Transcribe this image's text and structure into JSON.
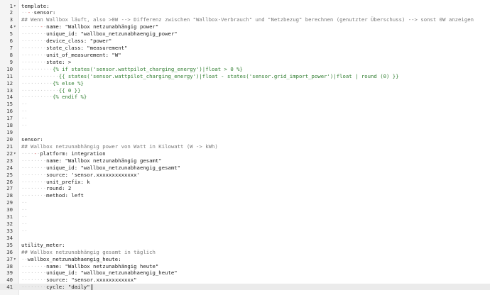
{
  "editor": {
    "active_line": 41,
    "lines": [
      {
        "n": "1",
        "fold": "▾",
        "segs": [
          [
            "k",
            "template:"
          ]
        ]
      },
      {
        "n": "2",
        "fold": "",
        "segs": [
          [
            "ws",
            "··"
          ],
          [
            "dash",
            "-"
          ],
          [
            "ws",
            "·"
          ],
          [
            "k",
            "sensor:"
          ]
        ]
      },
      {
        "n": "3",
        "fold": "",
        "segs": [
          [
            "c",
            "## Wenn Wallbox läuft, also >0W --> Differenz zwischen \"Wallbox-Verbrauch\" und \"Netzbezug\" berechnen (genutzter Überschuss) --> sonst 0W anzeigen"
          ]
        ]
      },
      {
        "n": "4",
        "fold": "▾",
        "segs": [
          [
            "ws",
            "······"
          ],
          [
            "dash",
            "-"
          ],
          [
            "ws",
            "·"
          ],
          [
            "k",
            "name: "
          ],
          [
            "s",
            "\"Wallbox netzunabhängig power\""
          ]
        ]
      },
      {
        "n": "5",
        "fold": "",
        "segs": [
          [
            "ws",
            "········"
          ],
          [
            "k",
            "unique_id: "
          ],
          [
            "s",
            "\"wallbox_netzunabhaengig_power\""
          ]
        ]
      },
      {
        "n": "6",
        "fold": "",
        "segs": [
          [
            "ws",
            "········"
          ],
          [
            "k",
            "device_class: "
          ],
          [
            "s",
            "\"power\""
          ]
        ]
      },
      {
        "n": "7",
        "fold": "",
        "segs": [
          [
            "ws",
            "········"
          ],
          [
            "k",
            "state_class: "
          ],
          [
            "s",
            "\"measurement\""
          ]
        ]
      },
      {
        "n": "8",
        "fold": "",
        "segs": [
          [
            "ws",
            "········"
          ],
          [
            "k",
            "unit_of_measurement: "
          ],
          [
            "s",
            "\"W\""
          ]
        ]
      },
      {
        "n": "9",
        "fold": "",
        "segs": [
          [
            "ws",
            "········"
          ],
          [
            "k",
            "state: "
          ],
          [
            "s",
            ">"
          ]
        ]
      },
      {
        "n": "10",
        "fold": "",
        "segs": [
          [
            "ws",
            "··········"
          ],
          [
            "t",
            "{% if states('sensor.wattpilot_charging_energy')|float > 0 %}"
          ]
        ]
      },
      {
        "n": "11",
        "fold": "",
        "segs": [
          [
            "ws",
            "············"
          ],
          [
            "t",
            "{{ states('sensor.wattpilot_charging_energy')|float - states('sensor.grid_import_power')|float | round (0) }}"
          ]
        ]
      },
      {
        "n": "12",
        "fold": "",
        "segs": [
          [
            "ws",
            "··········"
          ],
          [
            "t",
            "{% else %}"
          ]
        ]
      },
      {
        "n": "13",
        "fold": "",
        "segs": [
          [
            "ws",
            "············"
          ],
          [
            "t",
            "{{ 0 }}"
          ]
        ]
      },
      {
        "n": "14",
        "fold": "",
        "segs": [
          [
            "ws",
            "··········"
          ],
          [
            "t",
            "{% endif %}"
          ]
        ]
      },
      {
        "n": "15",
        "fold": "",
        "segs": [
          [
            "ws",
            "··"
          ]
        ]
      },
      {
        "n": "16",
        "fold": "",
        "segs": [
          [
            "ws",
            "··"
          ]
        ]
      },
      {
        "n": "17",
        "fold": "",
        "segs": [
          [
            "ws",
            "··"
          ]
        ]
      },
      {
        "n": "18",
        "fold": "",
        "segs": [
          [
            "ws",
            "··"
          ]
        ]
      },
      {
        "n": "19",
        "fold": "",
        "segs": []
      },
      {
        "n": "20",
        "fold": "",
        "segs": [
          [
            "k",
            "sensor:"
          ]
        ]
      },
      {
        "n": "21",
        "fold": "",
        "segs": [
          [
            "c",
            "## Wallbox netzunabhängig power von Watt in Kilowatt (W -> kWh)"
          ]
        ]
      },
      {
        "n": "22",
        "fold": "▾",
        "segs": [
          [
            "ws",
            "····"
          ],
          [
            "dash",
            "-"
          ],
          [
            "ws",
            "·"
          ],
          [
            "k",
            "platform: "
          ],
          [
            "s",
            "integration"
          ]
        ]
      },
      {
        "n": "23",
        "fold": "",
        "segs": [
          [
            "ws",
            "········"
          ],
          [
            "k",
            "name: "
          ],
          [
            "s",
            "\"Wallbox netzunabhängig gesamt\""
          ]
        ]
      },
      {
        "n": "24",
        "fold": "",
        "segs": [
          [
            "ws",
            "········"
          ],
          [
            "k",
            "unique_id: "
          ],
          [
            "s",
            "\"wallbox_netzunabhaengig_gesamt\""
          ]
        ]
      },
      {
        "n": "25",
        "fold": "",
        "segs": [
          [
            "ws",
            "········"
          ],
          [
            "k",
            "source: "
          ],
          [
            "s",
            "'sensor.xxxxxxxxxxxxx'"
          ]
        ]
      },
      {
        "n": "26",
        "fold": "",
        "segs": [
          [
            "ws",
            "········"
          ],
          [
            "k",
            "unit_prefix: "
          ],
          [
            "s",
            "k"
          ]
        ]
      },
      {
        "n": "27",
        "fold": "",
        "segs": [
          [
            "ws",
            "········"
          ],
          [
            "k",
            "round: "
          ],
          [
            "num",
            "2"
          ]
        ]
      },
      {
        "n": "28",
        "fold": "",
        "segs": [
          [
            "ws",
            "········"
          ],
          [
            "k",
            "method: "
          ],
          [
            "s",
            "left"
          ]
        ]
      },
      {
        "n": "29",
        "fold": "",
        "segs": [
          [
            "ws",
            "··"
          ]
        ]
      },
      {
        "n": "30",
        "fold": "",
        "segs": [
          [
            "ws",
            "··"
          ]
        ]
      },
      {
        "n": "31",
        "fold": "",
        "segs": [
          [
            "ws",
            "··"
          ]
        ]
      },
      {
        "n": "32",
        "fold": "",
        "segs": [
          [
            "ws",
            "··"
          ]
        ]
      },
      {
        "n": "33",
        "fold": "",
        "segs": [
          [
            "ws",
            "··"
          ]
        ]
      },
      {
        "n": "34",
        "fold": "",
        "segs": []
      },
      {
        "n": "35",
        "fold": "",
        "segs": [
          [
            "k",
            "utility_meter:"
          ]
        ]
      },
      {
        "n": "36",
        "fold": "",
        "segs": [
          [
            "c",
            "## Wallbox netzunabhängig gesamt in täglich"
          ]
        ]
      },
      {
        "n": "37",
        "fold": "▾",
        "segs": [
          [
            "ws",
            "··"
          ],
          [
            "k",
            "wallbox_netzunabhaengig_heute:"
          ]
        ]
      },
      {
        "n": "38",
        "fold": "",
        "segs": [
          [
            "ws",
            "········"
          ],
          [
            "k",
            "name: "
          ],
          [
            "s",
            "\"Wallbox netzunabhängig heute\""
          ]
        ]
      },
      {
        "n": "39",
        "fold": "",
        "segs": [
          [
            "ws",
            "········"
          ],
          [
            "k",
            "unique_id: "
          ],
          [
            "s",
            "\"wallbox_netzunabhaengig_heute\""
          ]
        ]
      },
      {
        "n": "40",
        "fold": "",
        "segs": [
          [
            "ws",
            "········"
          ],
          [
            "k",
            "source: "
          ],
          [
            "s",
            "\"sensor.xxxxxxxxxxxx\""
          ]
        ]
      },
      {
        "n": "41",
        "fold": "",
        "segs": [
          [
            "ws",
            "········"
          ],
          [
            "k",
            "cycle: "
          ],
          [
            "s",
            "\"daily\""
          ]
        ]
      }
    ]
  }
}
